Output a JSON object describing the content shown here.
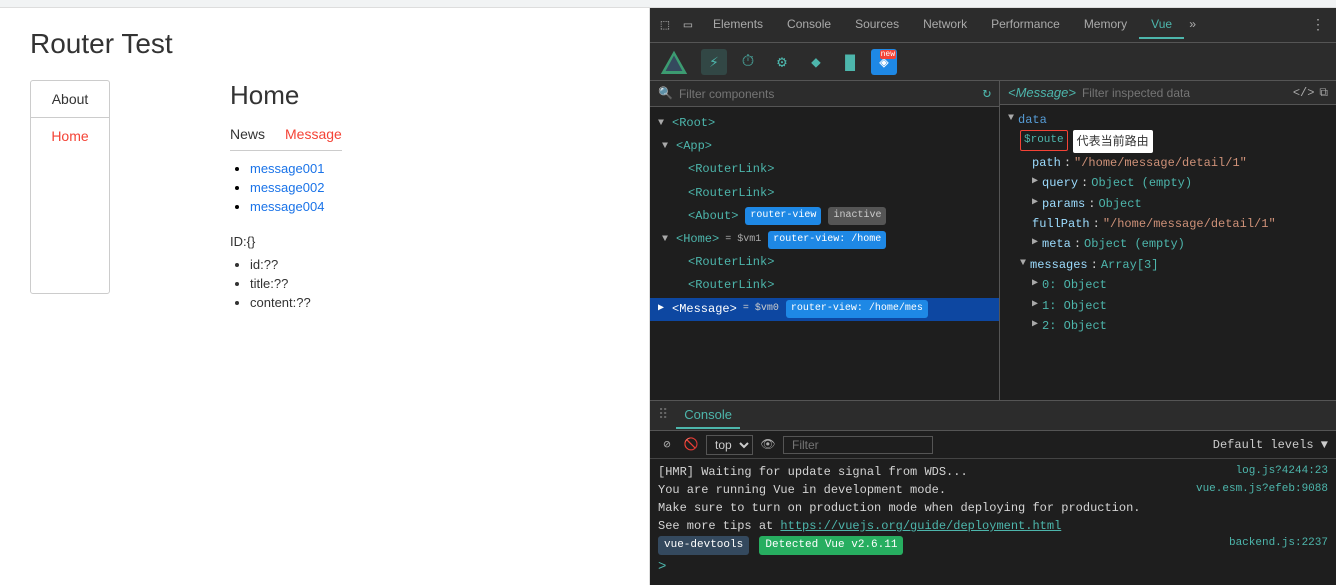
{
  "app": {
    "title": "Router Test"
  },
  "nav": {
    "about_label": "About",
    "home_label": "Home"
  },
  "content": {
    "page_title": "Home",
    "tab_news": "News",
    "tab_message": "Message",
    "messages": [
      {
        "text": "message001"
      },
      {
        "text": "message002"
      },
      {
        "text": "message004"
      }
    ],
    "id_label": "ID:{}",
    "id_fields": [
      {
        "text": "id:??"
      },
      {
        "text": "title:??"
      },
      {
        "text": "content:??"
      }
    ]
  },
  "devtools": {
    "tabs": [
      {
        "label": "Elements"
      },
      {
        "label": "Console"
      },
      {
        "label": "Sources"
      },
      {
        "label": "Network"
      },
      {
        "label": "Performance"
      },
      {
        "label": "Memory"
      },
      {
        "label": "Vue",
        "active": true
      }
    ],
    "vue_toolbar_buttons": [
      {
        "icon": "⚡",
        "label": "components",
        "active": true
      },
      {
        "icon": "⏱",
        "label": "timeline"
      },
      {
        "icon": "⚙",
        "label": "settings"
      },
      {
        "icon": "◆",
        "label": "routes"
      },
      {
        "icon": "▇",
        "label": "vuex"
      },
      {
        "icon": "◈",
        "label": "new-feature"
      }
    ],
    "component_tree": {
      "filter_placeholder": "Filter components",
      "items": [
        {
          "indent": 0,
          "arrow": "▼",
          "tag": "<Root>",
          "badges": []
        },
        {
          "indent": 1,
          "arrow": "▼",
          "tag": "<App>",
          "badges": []
        },
        {
          "indent": 2,
          "arrow": "",
          "tag": "<RouterLink>",
          "badges": []
        },
        {
          "indent": 2,
          "arrow": "",
          "tag": "<RouterLink>",
          "badges": []
        },
        {
          "indent": 2,
          "arrow": "",
          "tag": "<About>",
          "badges": [
            {
              "text": "router-view",
              "type": "router-view"
            },
            {
              "text": "inactive",
              "type": "inactive"
            }
          ]
        },
        {
          "indent": 1,
          "arrow": "▼",
          "tag": "<Home>",
          "vm": "= $vm1",
          "badges": [
            {
              "text": "router-view: /home",
              "type": "home"
            }
          ]
        },
        {
          "indent": 2,
          "arrow": "",
          "tag": "<RouterLink>",
          "badges": []
        },
        {
          "indent": 2,
          "arrow": "",
          "tag": "<RouterLink>",
          "badges": []
        },
        {
          "indent": 1,
          "arrow": "▼",
          "tag": "<Message>",
          "vm": "= $vm0",
          "badges": [
            {
              "text": "router-view: /home/mes",
              "type": "home"
            }
          ],
          "selected": true
        }
      ]
    },
    "inspector": {
      "title": "<Message>",
      "filter_placeholder": "Filter inspected data",
      "data": {
        "root_key": "data",
        "route_key": "$route",
        "route_annotation": "代表当前路由",
        "path_val": "\"/home/message/detail/1\"",
        "query": "Object (empty)",
        "params": "Object",
        "fullPath": "\"/home/message/detail/1\"",
        "meta": "Object (empty)",
        "messages_key": "messages",
        "messages_type": "Array[3]",
        "item0": "0: Object",
        "item1": "1: Object",
        "item2": "2: Object"
      }
    }
  },
  "console": {
    "tab_label": "Console",
    "top_label": "top",
    "filter_placeholder": "Filter",
    "default_levels": "Default levels ▼",
    "lines": [
      {
        "text": "[HMR] Waiting for update signal from WDS...",
        "source": "log.js?4244:23"
      },
      {
        "text": "You are running Vue in development mode.",
        "source": "vue.esm.js?efeb:9088"
      },
      {
        "text": "Make sure to turn on production mode when deploying for production.",
        "source": ""
      },
      {
        "text": "See more tips at ",
        "link": "https://vuejs.org/guide/deployment.html",
        "source": ""
      }
    ],
    "devtools_badge": "vue-devtools",
    "detected_badge": "Detected Vue v2.6.11",
    "backend_source": "backend.js:2237"
  }
}
